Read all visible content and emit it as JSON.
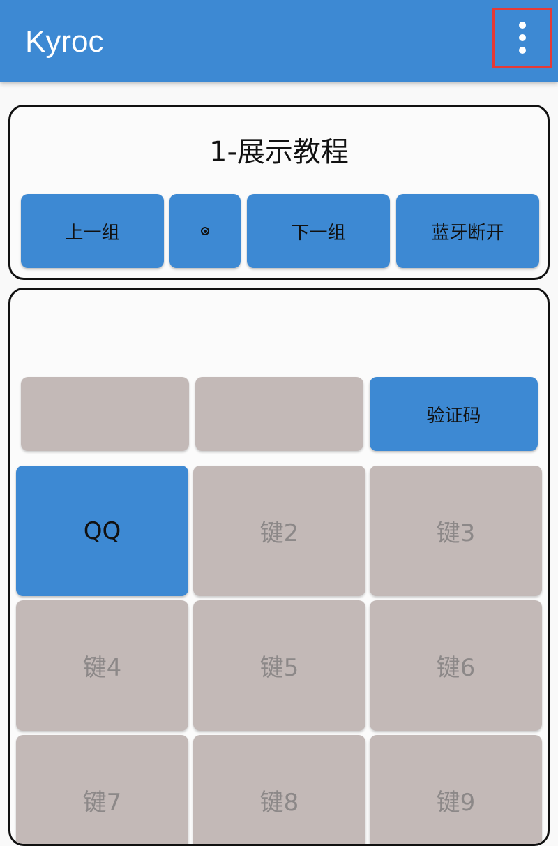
{
  "appbar": {
    "title": "Kyroc",
    "more_icon": "more-vert-icon"
  },
  "group_panel": {
    "title": "1-展示教程",
    "buttons": {
      "prev": "上一组",
      "center_icon": "radio-dot-icon",
      "next": "下一组",
      "bluetooth": "蓝牙断开"
    }
  },
  "key_panel": {
    "top_row": [
      "",
      "",
      "验证码"
    ],
    "keys": [
      "QQ",
      "键2",
      "键3",
      "键4",
      "键5",
      "键6",
      "键7",
      "键8",
      "键9"
    ]
  },
  "colors": {
    "accent": "#3d89d3",
    "inactive_key": "#c3b9b7",
    "highlight_border": "#e53935"
  }
}
